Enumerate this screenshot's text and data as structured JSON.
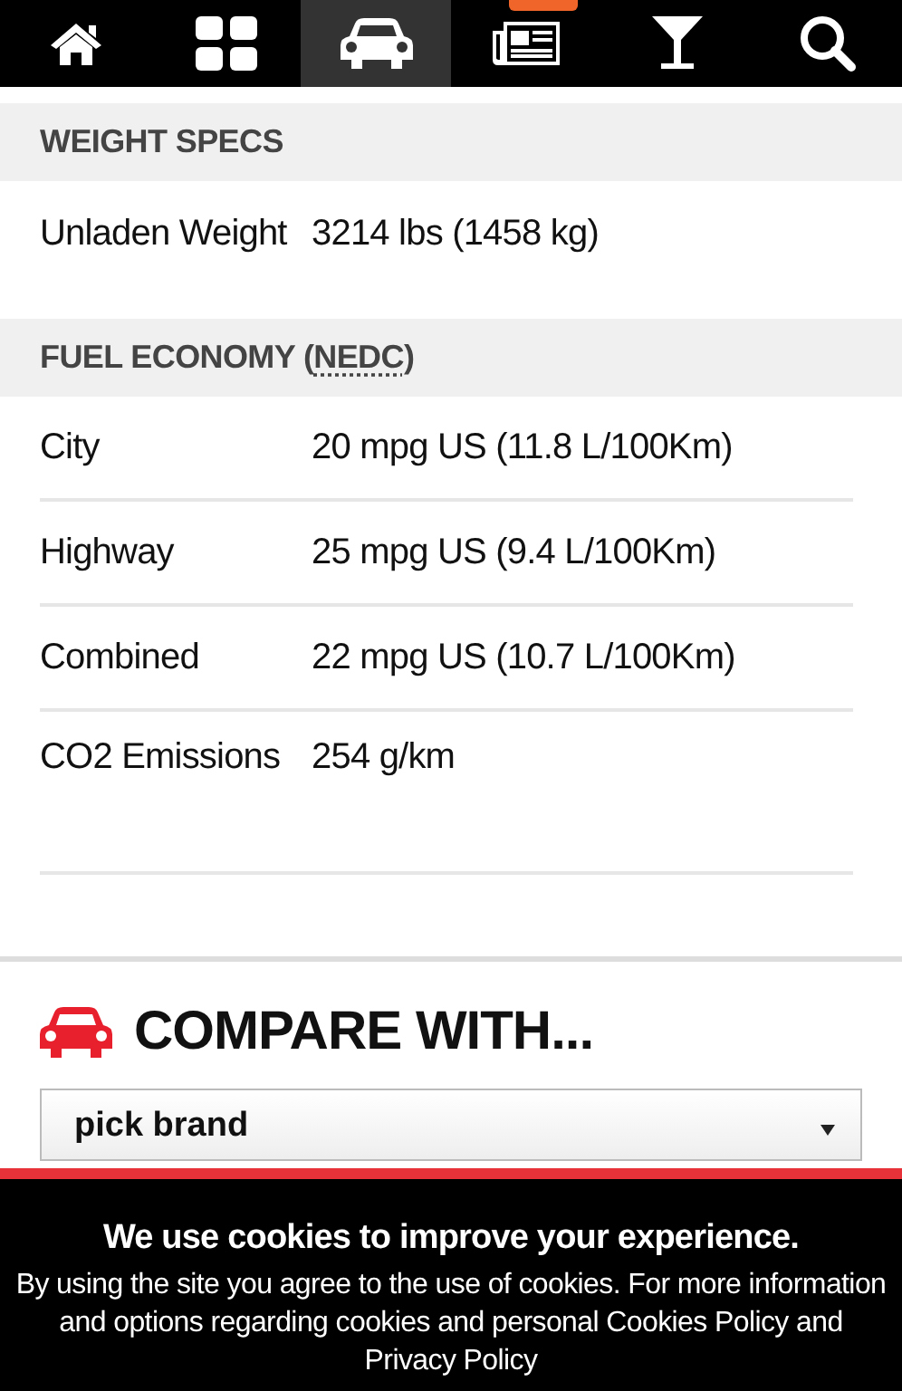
{
  "nav": {
    "items": [
      {
        "kind": "home",
        "selected": false,
        "badge": false
      },
      {
        "kind": "grid",
        "selected": false,
        "badge": false
      },
      {
        "kind": "car",
        "selected": true,
        "badge": false
      },
      {
        "kind": "news",
        "selected": false,
        "badge": true
      },
      {
        "kind": "cocktail",
        "selected": false,
        "badge": false
      },
      {
        "kind": "search",
        "selected": false,
        "badge": false
      }
    ]
  },
  "sections": [
    {
      "title": [
        {
          "text": "WEIGHT SPECS",
          "abbr": false
        }
      ],
      "rows": [
        {
          "label": "Unladen Weight",
          "value": "3214 lbs (1458 kg)"
        }
      ]
    },
    {
      "title": [
        {
          "text": "FUEL ECONOMY (",
          "abbr": false
        },
        {
          "text": "NEDC",
          "abbr": true
        },
        {
          "text": ")",
          "abbr": false
        }
      ],
      "rows": [
        {
          "label": "City",
          "value": "20 mpg US (11.8 L/100Km)"
        },
        {
          "label": "Highway",
          "value": "25 mpg US (9.4 L/100Km)"
        },
        {
          "label": "Combined",
          "value": "22 mpg US (10.7 L/100Km)"
        },
        {
          "label": "CO2 Emissions",
          "value": "254 g/km"
        }
      ]
    }
  ],
  "compare": {
    "title": "COMPARE WITH...",
    "select": {
      "value": "pick brand"
    }
  },
  "cookie_banner": {
    "title": "We use cookies to improve your experience.",
    "text": "By using the site you agree to the use of cookies. For more information and options regarding cookies and personal",
    "links": [
      "Cookies Policy",
      "Privacy Policy"
    ],
    "joiner": "and"
  }
}
